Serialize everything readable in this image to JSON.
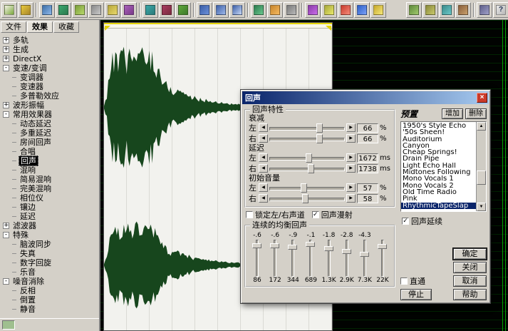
{
  "ui": {
    "arrow_left": "◀",
    "arrow_right": "▶",
    "scroll_up": "▲",
    "scroll_down": "▼",
    "check": "✓",
    "close_glyph": "×"
  },
  "colors": {
    "selection": "#0a246a",
    "waveform": "#17461d",
    "titlebar_start": "#0a246a",
    "titlebar_end": "#a6caf0"
  },
  "toolbar": {
    "items": [
      {
        "name": "new-file-icon",
        "colors": [
          "#f5f2e8",
          "#7aa83b"
        ]
      },
      {
        "name": "open-file-icon",
        "colors": [
          "#e8c93b",
          "#a8862b"
        ]
      },
      {
        "sep": true
      },
      {
        "name": "save-icon",
        "colors": [
          "#3b6ea8",
          "#8fb8e8"
        ]
      },
      {
        "name": "undo-icon",
        "colors": [
          "#3ba86e",
          "#2b7a4e"
        ]
      },
      {
        "name": "redo-icon",
        "colors": [
          "#7a9e3b",
          "#b8d86b"
        ]
      },
      {
        "name": "cut-icon",
        "colors": [
          "#8a8a8a",
          "#c8c8c8"
        ]
      },
      {
        "name": "copy-icon",
        "colors": [
          "#b8a83b",
          "#e8d86b"
        ]
      },
      {
        "name": "paste-icon",
        "colors": [
          "#a85fb8",
          "#7a3b8a"
        ]
      },
      {
        "sep": true
      },
      {
        "name": "mix-paste-icon",
        "colors": [
          "#3ba8a8",
          "#2b7a7a"
        ]
      },
      {
        "name": "delete-icon",
        "colors": [
          "#a83b5f",
          "#7a2b3f"
        ]
      },
      {
        "name": "trim-icon",
        "colors": [
          "#5fa83b",
          "#3f7a2b"
        ]
      },
      {
        "sep": true
      },
      {
        "name": "zoom-in-icon",
        "colors": [
          "#3b5fa8",
          "#6b8fd8"
        ]
      },
      {
        "name": "zoom-out-icon",
        "colors": [
          "#3b5fa8",
          "#9fb8e8"
        ]
      },
      {
        "name": "zoom-selection-icon",
        "colors": [
          "#3b5fa8",
          "#c8d8f5"
        ]
      },
      {
        "sep": true
      },
      {
        "name": "waveform-view-icon",
        "colors": [
          "#2b7a4e",
          "#6bc88e"
        ]
      },
      {
        "name": "spectral-view-icon",
        "colors": [
          "#c8862b",
          "#f5b85f"
        ]
      },
      {
        "name": "cue-list-icon",
        "colors": [
          "#7a7a7a",
          "#b8b8b8"
        ]
      },
      {
        "sep": true
      },
      {
        "name": "effects-rack-icon",
        "colors": [
          "#8a3ba8",
          "#c86be8"
        ]
      },
      {
        "name": "envelope-icon",
        "colors": [
          "#a8a83b",
          "#e8e86b"
        ]
      },
      {
        "name": "record-icon",
        "colors": [
          "#c83b2b",
          "#f58a7a"
        ]
      },
      {
        "name": "loop-icon",
        "colors": [
          "#2b5fc8",
          "#7a9ff5"
        ]
      },
      {
        "name": "multitrack-icon",
        "colors": [
          "#c8a82b",
          "#f5e87a"
        ]
      },
      {
        "gap": true
      },
      {
        "name": "scripts-icon",
        "colors": [
          "#5f8a3b",
          "#9fc86b"
        ]
      },
      {
        "name": "cd-burn-icon",
        "colors": [
          "#8a8a3b",
          "#c8c86b"
        ]
      },
      {
        "name": "options-icon",
        "colors": [
          "#3b8a8a",
          "#6bc8c8"
        ]
      },
      {
        "name": "settings-icon",
        "colors": [
          "#8a5f3b",
          "#c89f6b"
        ]
      },
      {
        "sep": true
      },
      {
        "name": "device-icon",
        "colors": [
          "#5f5f8a",
          "#9f9fc8"
        ]
      },
      {
        "name": "help-icon",
        "colors": [
          "#e8e8e8",
          "#b8b8b8"
        ],
        "glyph": "?"
      }
    ]
  },
  "sidebar": {
    "tabs": [
      {
        "label": "文件",
        "active": false
      },
      {
        "label": "效果",
        "active": true
      },
      {
        "label": "收藏",
        "active": false
      }
    ],
    "tree": [
      {
        "label": "多轨",
        "level": 0,
        "exp": "+"
      },
      {
        "label": "生成",
        "level": 0,
        "exp": "+"
      },
      {
        "label": "DirectX",
        "level": 0,
        "exp": "+"
      },
      {
        "label": "变速/变调",
        "level": 0,
        "exp": "-"
      },
      {
        "label": "变调器",
        "level": 1
      },
      {
        "label": "变速器",
        "level": 1
      },
      {
        "label": "多普勒效应",
        "level": 1
      },
      {
        "label": "波形振幅",
        "level": 0,
        "exp": "+"
      },
      {
        "label": "常用效果器",
        "level": 0,
        "exp": "-"
      },
      {
        "label": "动态延迟",
        "level": 1
      },
      {
        "label": "多重延迟",
        "level": 1
      },
      {
        "label": "房间回声",
        "level": 1
      },
      {
        "label": "合唱",
        "level": 1
      },
      {
        "label": "回声",
        "level": 1,
        "selected": true
      },
      {
        "label": "混响",
        "level": 1
      },
      {
        "label": "简易混响",
        "level": 1
      },
      {
        "label": "完美混响",
        "level": 1
      },
      {
        "label": "相位仪",
        "level": 1
      },
      {
        "label": "镶边",
        "level": 1
      },
      {
        "label": "延迟",
        "level": 1
      },
      {
        "label": "滤波器",
        "level": 0,
        "exp": "+"
      },
      {
        "label": "特殊",
        "level": 0,
        "exp": "-"
      },
      {
        "label": "脑波同步",
        "level": 1
      },
      {
        "label": "失真",
        "level": 1
      },
      {
        "label": "数字回旋",
        "level": 1
      },
      {
        "label": "乐音",
        "level": 1
      },
      {
        "label": "噪音消除",
        "level": 0,
        "exp": "-"
      },
      {
        "label": "反相",
        "level": 1
      },
      {
        "label": "倒置",
        "level": 1
      },
      {
        "label": "静音",
        "level": 1
      }
    ]
  },
  "dialog": {
    "title": "回声",
    "characteristics": {
      "title": "回声特性",
      "decay": {
        "label": "衰减",
        "left": {
          "side": "左",
          "value": "66",
          "unit": "%",
          "pct": 66
        },
        "right": {
          "side": "右",
          "value": "66",
          "unit": "%",
          "pct": 66
        }
      },
      "delay": {
        "label": "延迟",
        "left": {
          "side": "左",
          "value": "1672",
          "unit": "ms",
          "pct": 52
        },
        "right": {
          "side": "右",
          "value": "1738",
          "unit": "ms",
          "pct": 55
        }
      },
      "initial": {
        "label": "初始音量",
        "left": {
          "side": "左",
          "value": "57",
          "unit": "%",
          "pct": 45
        },
        "right": {
          "side": "右",
          "value": "58",
          "unit": "%",
          "pct": 47
        }
      },
      "lock_label": "锁定左/右声道",
      "lock_checked": false,
      "diffuse_label": "回声漫射",
      "diffuse_checked": true
    },
    "eq": {
      "title": "连续的均衡回声",
      "values": [
        "-.6",
        "-.6",
        "-.9",
        "-.1",
        "-1.8",
        "-2.8",
        "-4.3"
      ],
      "freqs": [
        "86",
        "172",
        "344",
        "689",
        "1.3K",
        "2.9K",
        "7.3K",
        "22K"
      ],
      "thumb_tops": [
        10,
        10,
        14,
        6,
        18,
        25,
        33,
        12
      ]
    },
    "presets": {
      "label": "预置",
      "add_label": "增加",
      "delete_label": "删除",
      "items": [
        "1950's Style Echo",
        "'50s Sheen!",
        "Auditorium",
        "Canyon",
        "Cheap Springs!",
        "Drain Pipe",
        "Light Echo Hall",
        "Midtones Following",
        "Mono Vocals 1",
        "Mono Vocals 2",
        "Old Time Radio",
        "Pink",
        "RhythmicTapeSlap"
      ],
      "selected": "RhythmicTapeSlap"
    },
    "echo_continue_label": "回声延续",
    "echo_continue_checked": true,
    "bypass_label": "直通",
    "bypass_checked": false,
    "buttons": {
      "ok": "确定",
      "close": "关闭",
      "cancel": "取消",
      "help": "帮助",
      "stop": "停止"
    }
  }
}
